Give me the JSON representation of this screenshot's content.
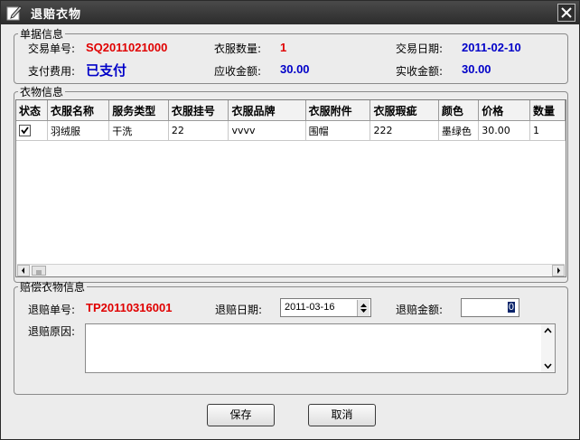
{
  "window": {
    "title": "退赔衣物"
  },
  "receipt": {
    "legend": "单据信息",
    "order_no_label": "交易单号:",
    "order_no": "SQ2011021000",
    "qty_label": "衣服数量:",
    "qty": "1",
    "date_label": "交易日期:",
    "date": "2011-02-10",
    "pay_label": "支付费用:",
    "pay": "已支付",
    "due_label": "应收金额:",
    "due": "30.00",
    "received_label": "实收金额:",
    "received": "30.00"
  },
  "clothes": {
    "legend": "衣物信息",
    "columns": [
      "状态",
      "衣服名称",
      "服务类型",
      "衣服挂号",
      "衣服品牌",
      "衣服附件",
      "衣服瑕疵",
      "颜色",
      "价格",
      "数量"
    ],
    "rows": [
      {
        "checked": true,
        "cells": [
          "羽绒服",
          "干洗",
          "22",
          "vvvv",
          "围帽",
          "222",
          "墨绿色",
          "30.00",
          "1"
        ]
      }
    ]
  },
  "compensation": {
    "legend": "赔偿衣物信息",
    "refund_no_label": "退赔单号:",
    "refund_no": "TP20110316001",
    "refund_date_label": "退赔日期:",
    "refund_date": "2011-03-16",
    "amount_label": "退赔金额:",
    "amount": "0",
    "reason_label": "退赔原因:",
    "reason": ""
  },
  "buttons": {
    "save": "保存",
    "cancel": "取消"
  },
  "colors": {
    "red_value": "#e00000",
    "blue_value": "#0000c8",
    "titlebar": "#2c2c2c"
  }
}
